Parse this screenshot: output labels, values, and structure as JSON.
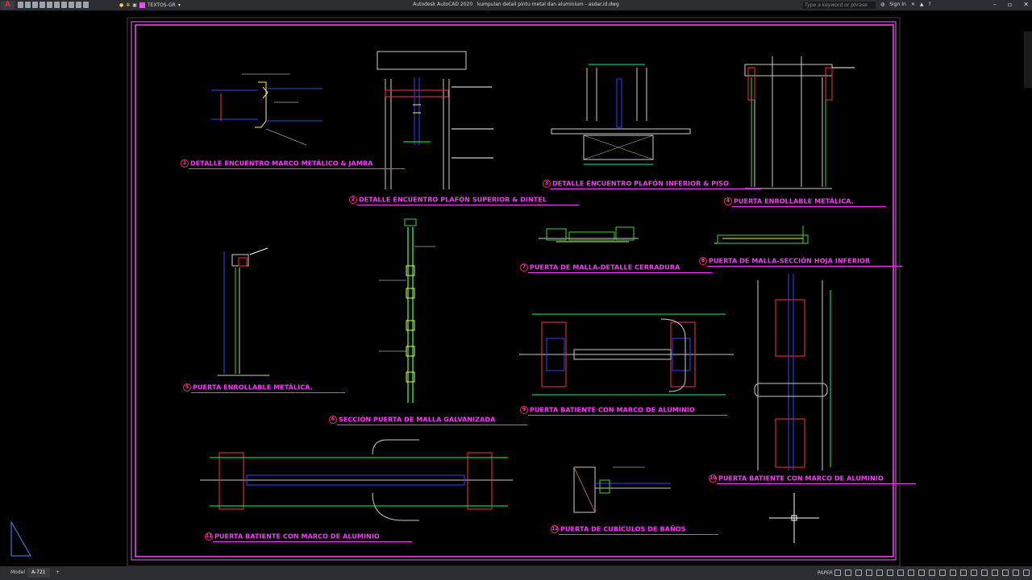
{
  "app": {
    "title": "Autodesk AutoCAD 2020",
    "file": "kumpulan detail pintu metal dan aluminium - asdar.id.dwg",
    "search_placeholder": "Type a keyword or phrase",
    "sign_in": "Sign In",
    "current_layer": "TEXTOS-GR"
  },
  "colors": {
    "title_text": "#ff33ff",
    "number_circle": "#ff2a2a",
    "frame": "#ff66ff",
    "dim": "#00ff66",
    "glass": "#3344ff",
    "steel": "#ff3333"
  },
  "details": [
    {
      "num": "1",
      "label": "DETALLE ENCUENTRO MARCO METÁLICO & JAMBA"
    },
    {
      "num": "2",
      "label": "DETALLE ENCUENTRO PLAFÓN SUPERIOR & DINTEL"
    },
    {
      "num": "3",
      "label": "DETALLE ENCUENTRO PLAFÓN INFERIOR & PISO"
    },
    {
      "num": "4",
      "label": "PUERTA ENROLLABLE METÁLICA."
    },
    {
      "num": "5",
      "label": "PUERTA ENROLLABLE METÁLICA."
    },
    {
      "num": "6",
      "label": "SECCIÓN PUERTA DE MALLA GALVANIZADA"
    },
    {
      "num": "7",
      "label": "PUERTA DE MALLA-DETALLE CERRADURA"
    },
    {
      "num": "8",
      "label": "PUERTA DE MALLA-SECCIÓN HOJA INFERIOR"
    },
    {
      "num": "9",
      "label": "PUERTA BATIENTE CON MARCO DE ALUMINIO"
    },
    {
      "num": "10",
      "label": "PUERTA BATIENTE CON MARCO DE ALUMINIO"
    },
    {
      "num": "11",
      "label": "PUERTA BATIENTE CON MARCO DE ALUMINIO"
    },
    {
      "num": "12",
      "label": "PUERTA DE CUBÍCULOS DE BAÑOS"
    }
  ],
  "status": {
    "tabs": [
      "Model",
      "A-721"
    ],
    "active_tab": "A-721",
    "add_tab": "+",
    "space": "PAPER"
  }
}
